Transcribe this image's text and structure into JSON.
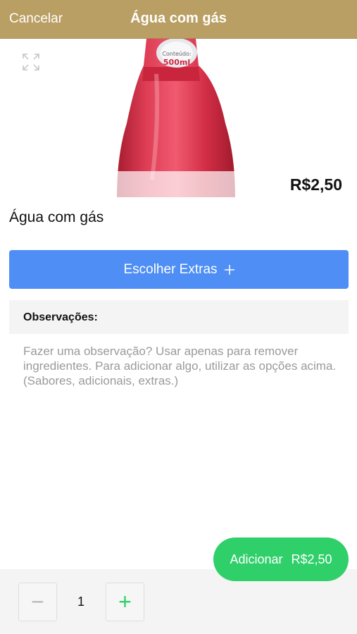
{
  "navbar": {
    "cancel_label": "Cancelar",
    "title": "Água com gás"
  },
  "product": {
    "name": "Água com gás",
    "price": "R$2,50"
  },
  "image": {
    "label_line1": "Conteúdo:",
    "label_line2": "500ml"
  },
  "extras": {
    "button_label": "Escolher Extras",
    "icon": "plus-icon"
  },
  "observations": {
    "header": "Observações:",
    "placeholder": "Fazer uma observação? Usar apenas para remover ingredientes. Para adicionar algo, utilizar as opções acima. (Sabores, adicionais, extras.)",
    "value": ""
  },
  "add_button": {
    "label": "Adicionar",
    "price": "R$2,50"
  },
  "quantity": {
    "value": "1",
    "minus_symbol": "−",
    "plus_symbol": "+"
  },
  "colors": {
    "navbar": "#b99f63",
    "primary_blue": "#4e8ef5",
    "add_green": "#2fd06a",
    "bottle_red": "#d8304a"
  }
}
